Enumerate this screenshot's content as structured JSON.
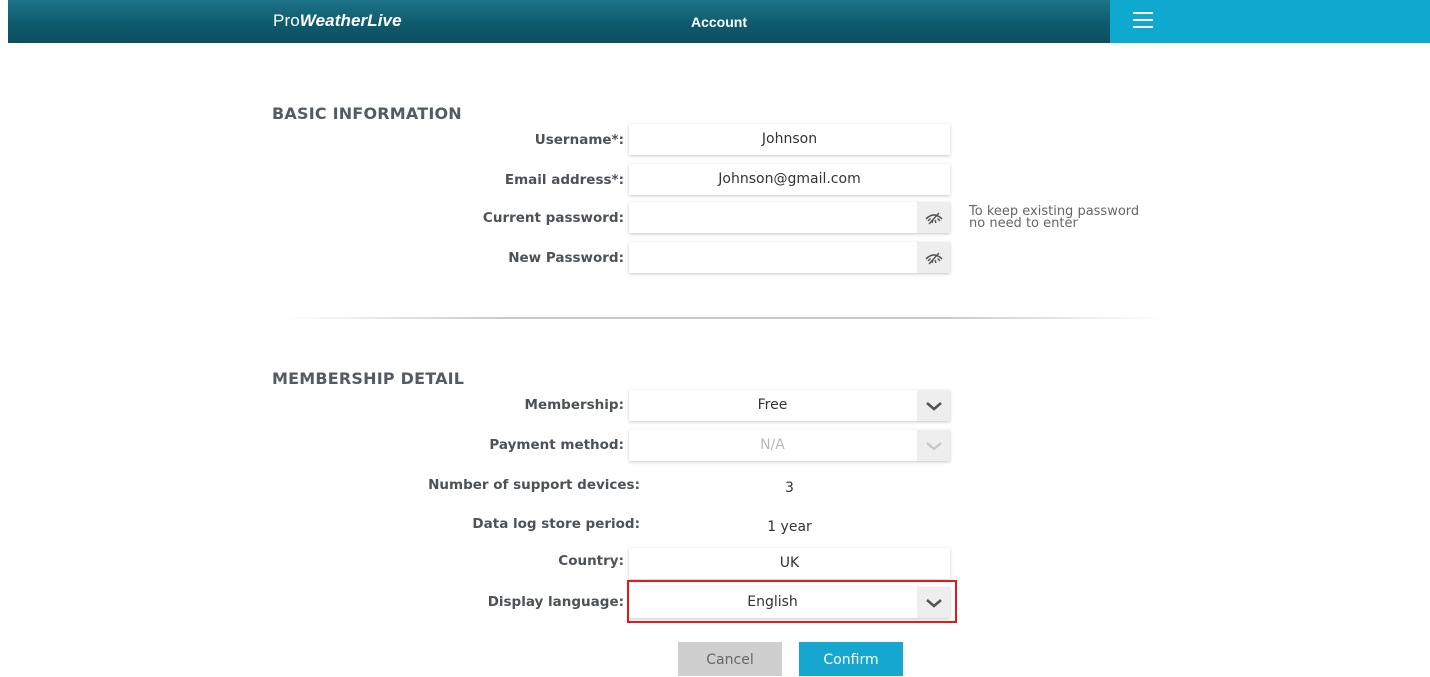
{
  "header": {
    "brand_prefix": "Pro",
    "brand_name": "WeatherLive",
    "page_title": "Account",
    "menu_icon": "hamburger-menu-icon"
  },
  "basic_information": {
    "title": "BASIC INFORMATION",
    "username": {
      "label": "Username*:",
      "value": "Johnson"
    },
    "email": {
      "label": "Email address*:",
      "value": "Johnson@gmail.com"
    },
    "current_password": {
      "label": "Current password:",
      "value": "",
      "icon": "eye-hidden-icon"
    },
    "new_password": {
      "label": "New Password:",
      "value": "",
      "icon": "eye-hidden-icon"
    },
    "password_hint_line1": "To keep existing password",
    "password_hint_line2": "no need to enter"
  },
  "membership_detail": {
    "title": "MEMBERSHIP DETAIL",
    "membership": {
      "label": "Membership:",
      "value": "Free",
      "icon": "chevron-down-icon"
    },
    "payment_method": {
      "label": "Payment method:",
      "value": "N/A",
      "icon": "chevron-down-icon",
      "disabled": true
    },
    "support_devices": {
      "label": "Number of support devices:",
      "value": "3"
    },
    "data_log_period": {
      "label": "Data log store period:",
      "value": "1 year"
    },
    "country": {
      "label": "Country:",
      "value": "UK"
    },
    "display_language": {
      "label": "Display language:",
      "value": "English",
      "icon": "chevron-down-icon",
      "highlighted": true
    }
  },
  "actions": {
    "cancel_label": "Cancel",
    "confirm_label": "Confirm"
  },
  "colors": {
    "header": "#0f5a6d",
    "menu_accent": "#0fa8cf",
    "confirm": "#15a7d0",
    "cancel": "#cfcfcf",
    "highlight": "#e3191c"
  }
}
